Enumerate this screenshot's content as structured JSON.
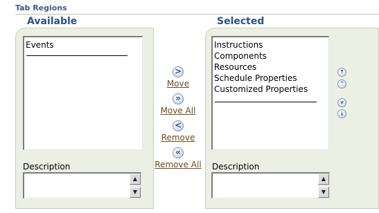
{
  "header": {
    "title": "Tab Regions"
  },
  "available": {
    "title": "Available",
    "items": [
      "Events"
    ],
    "description_label": "Description",
    "description_value": ""
  },
  "selected": {
    "title": "Selected",
    "items": [
      "Instructions",
      "Components",
      "Resources",
      "Schedule Properties",
      "Customized Properties"
    ],
    "description_label": "Description",
    "description_value": ""
  },
  "shuttle": {
    "move": {
      "label": "Move",
      "icon": "chevron-right-icon",
      "glyph": ">"
    },
    "move_all": {
      "label": "Move All",
      "icon": "double-chevron-right-icon",
      "glyph": "»"
    },
    "remove": {
      "label": "Remove",
      "icon": "chevron-left-icon",
      "glyph": "<"
    },
    "remove_all": {
      "label": "Remove All",
      "icon": "double-chevron-left-icon",
      "glyph": "«"
    }
  },
  "reorder": {
    "top_glyph": "⤒",
    "up_glyph": "^",
    "down_glyph": "v",
    "bottom_glyph": "⤓"
  },
  "colors": {
    "panel_bg": "#ecefe4",
    "title_blue": "#2d5285",
    "link_brown": "#6b4a1f"
  }
}
